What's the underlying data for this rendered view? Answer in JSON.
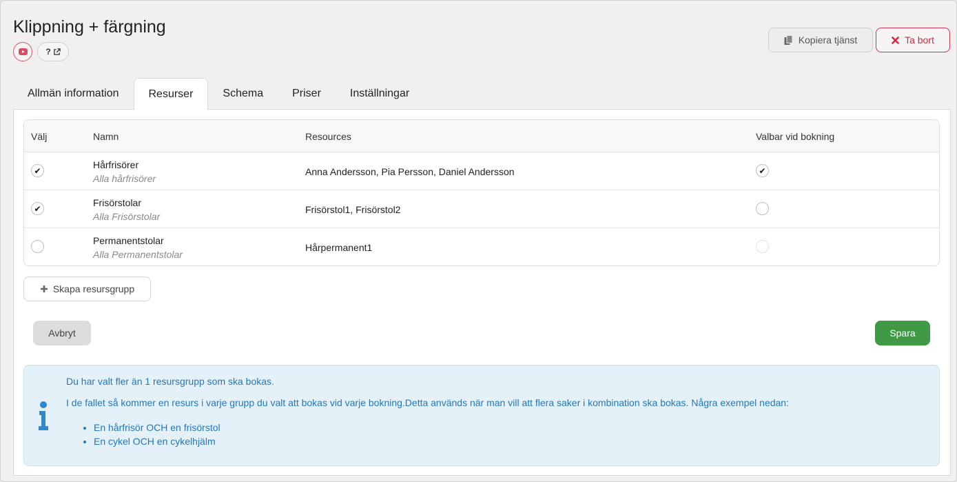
{
  "header": {
    "title": "Klippning + färgning",
    "help_label": "?",
    "copy_label": "Kopiera tjänst",
    "delete_label": "Ta bort"
  },
  "tabs": [
    {
      "label": "Allmän information",
      "active": false
    },
    {
      "label": "Resurser",
      "active": true
    },
    {
      "label": "Schema",
      "active": false
    },
    {
      "label": "Priser",
      "active": false
    },
    {
      "label": "Inställningar",
      "active": false
    }
  ],
  "table": {
    "headers": [
      "Välj",
      "Namn",
      "Resources",
      "Valbar vid bokning"
    ],
    "rows": [
      {
        "selected": true,
        "name": "Hårfrisörer",
        "subtitle": "Alla hårfrisörer",
        "resources": "Anna Andersson, Pia Persson, Daniel Andersson",
        "bookable": true,
        "bookable_enabled": true
      },
      {
        "selected": true,
        "name": "Frisörstolar",
        "subtitle": "Alla Frisörstolar",
        "resources": "Frisörstol1, Frisörstol2",
        "bookable": false,
        "bookable_enabled": true
      },
      {
        "selected": false,
        "name": "Permanentstolar",
        "subtitle": "Alla Permanentstolar",
        "resources": "Hårpermanent1",
        "bookable": false,
        "bookable_enabled": false
      }
    ]
  },
  "actions": {
    "create_group_label": "Skapa resursgrupp",
    "cancel_label": "Avbryt",
    "save_label": "Spara"
  },
  "info": {
    "line1": "Du har valt fler än 1 resursgrupp som ska bokas.",
    "line2": "I de fallet så kommer en resurs i varje grupp du valt att bokas vid varje bokning.Detta används när man vill att flera saker i kombination ska bokas. Några exempel nedan:",
    "examples": [
      "En hårfrisör OCH en frisörstol",
      "En cykel OCH en cykelhjälm"
    ]
  },
  "colors": {
    "save": "#3f9945",
    "delete": "#c62c45",
    "info_text": "#2377b8",
    "info_bg": "#e4f1f9"
  }
}
